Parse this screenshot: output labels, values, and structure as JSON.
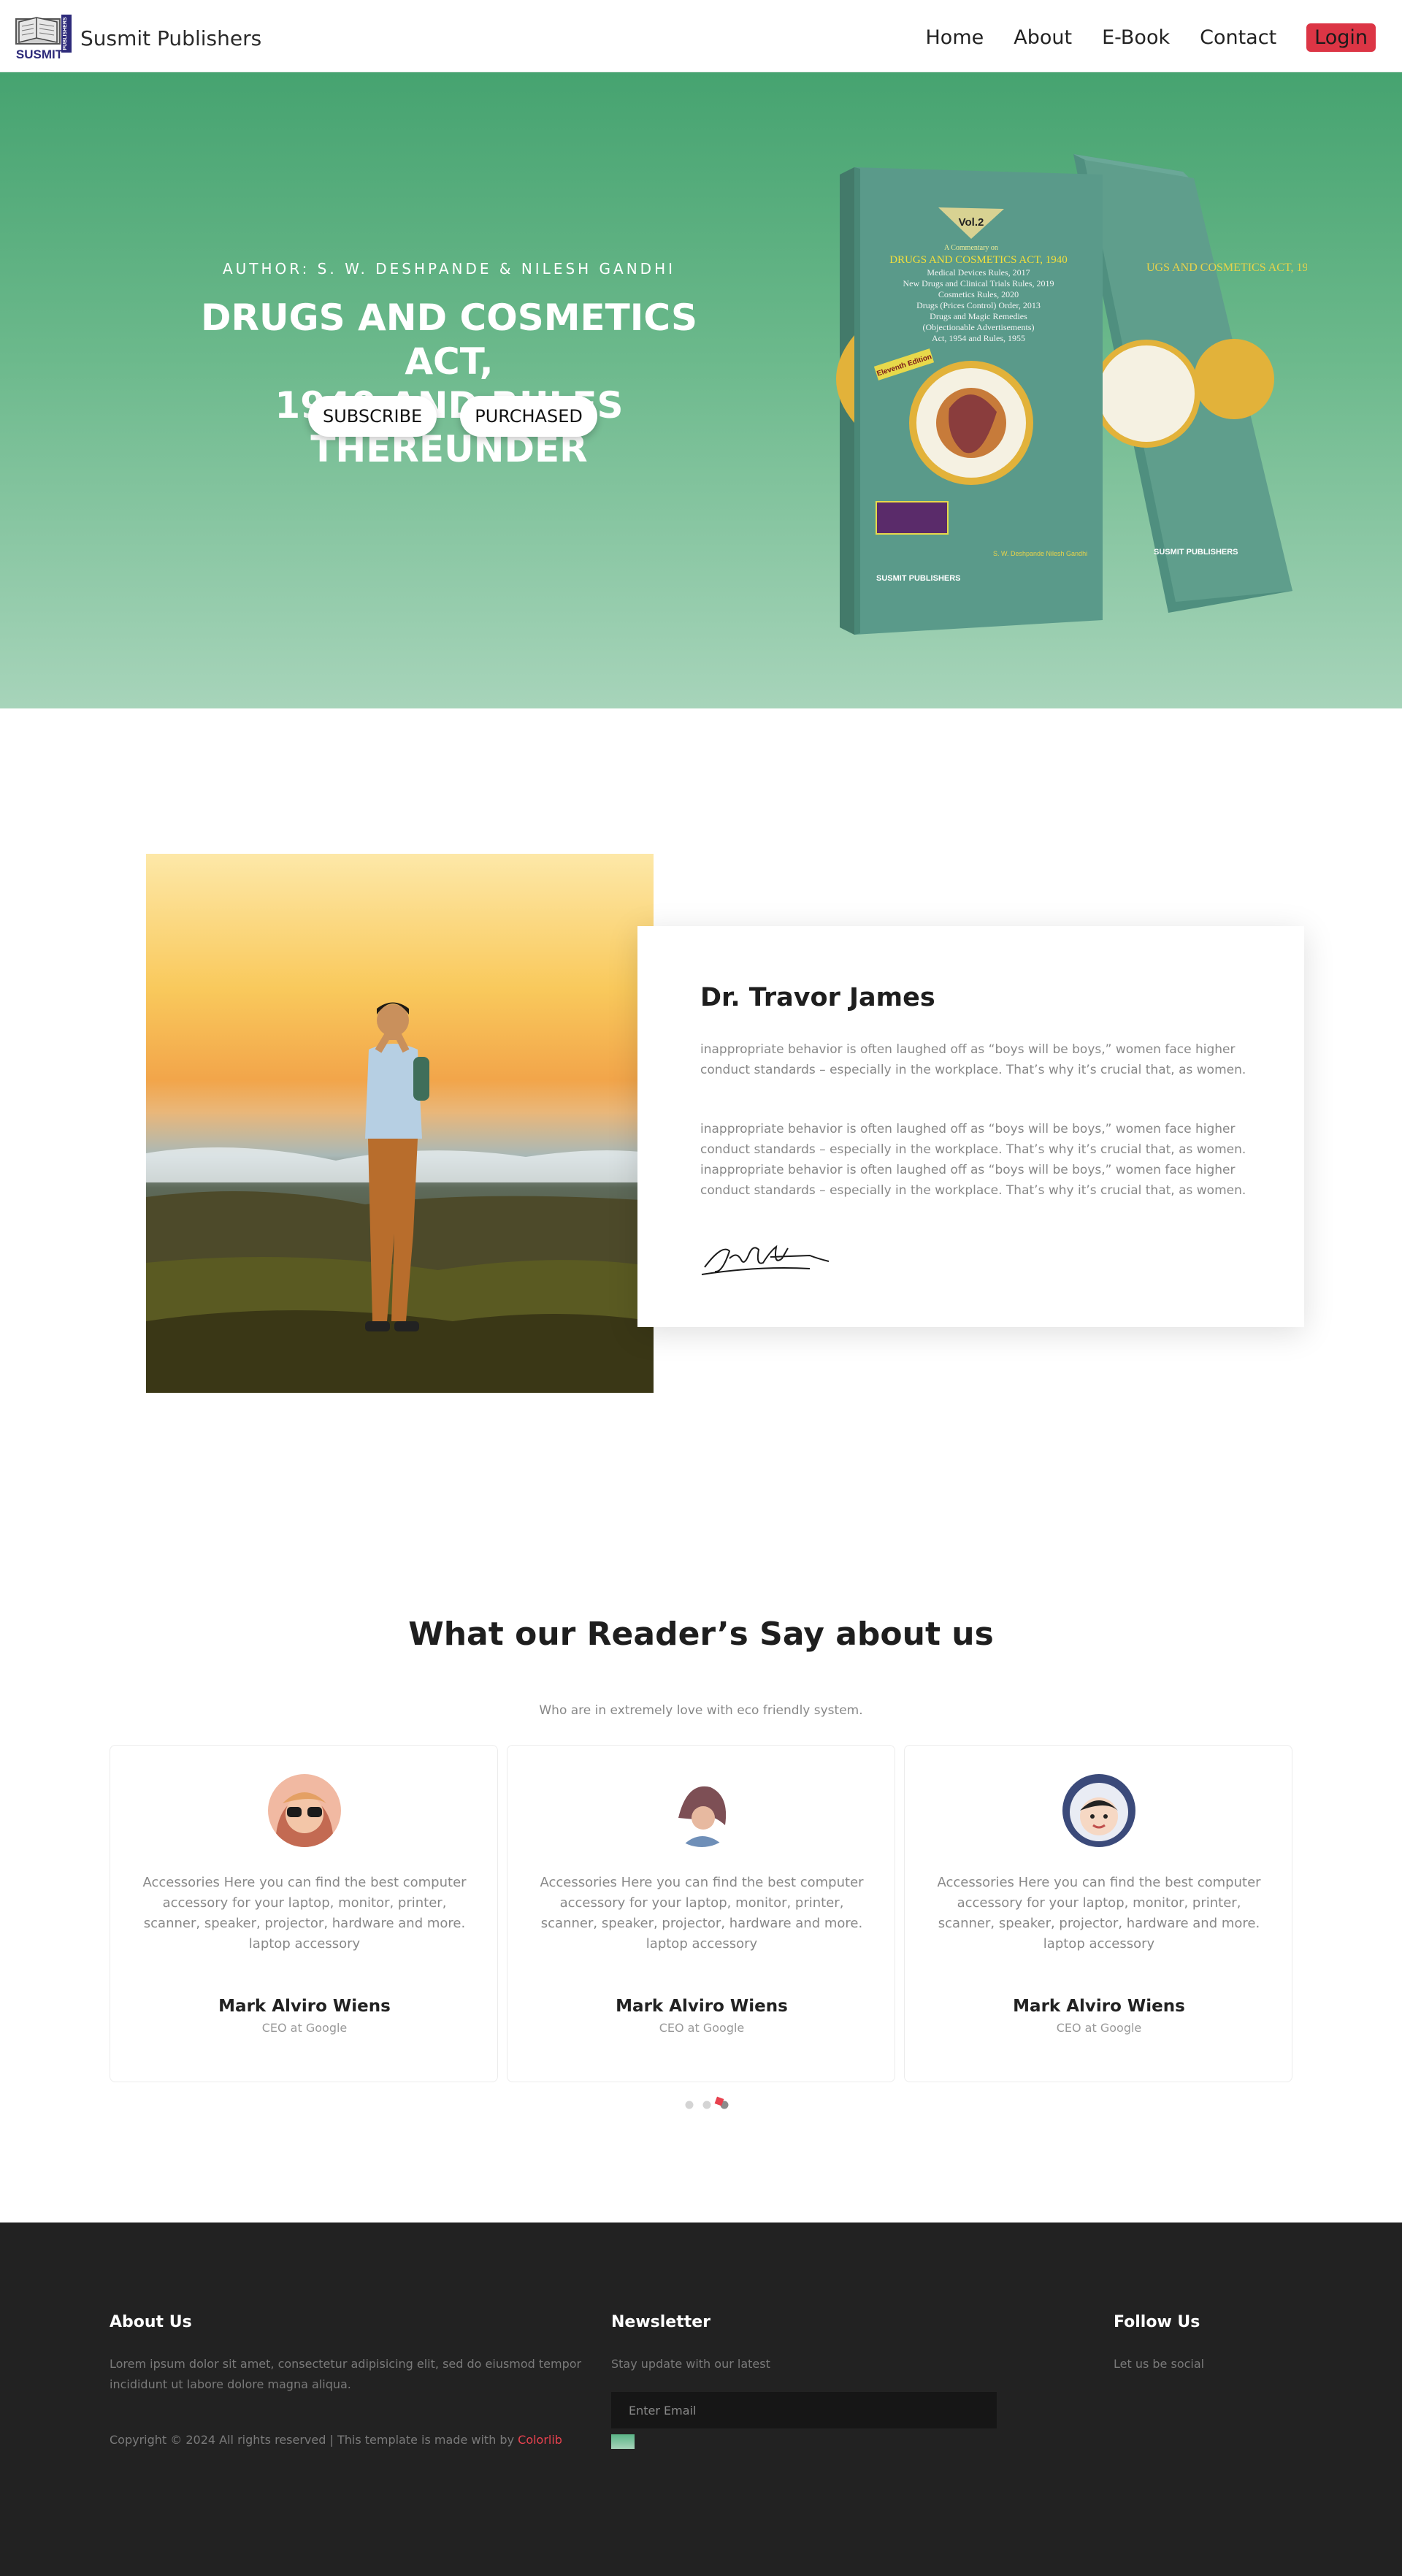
{
  "nav": {
    "logo_text": "SUSMIT",
    "logo_vertical": "PUBLISHERS",
    "brand": "Susmit Publishers",
    "links": [
      "Home",
      "About",
      "E-Book",
      "Contact"
    ],
    "login": "Login"
  },
  "hero": {
    "author": "AUTHOR: S. W. DESHPANDE & NILESH GANDHI",
    "title_line1": "DRUGS AND COSMETICS ACT,",
    "title_line2": "1940 AND RULES THEREUNDER",
    "subscribe": "SUBSCRIBE",
    "purchased": "PURCHASED",
    "book": {
      "vol": "Vol.2",
      "subtitle": "A Commentary on",
      "title": "DRUGS AND COSMETICS ACT, 1940",
      "lines": [
        "Medical Devices Rules, 2017",
        "New Drugs and Clinical Trials Rules, 2019",
        "Cosmetics Rules, 2020",
        "Drugs (Prices Control) Order, 2013",
        "Drugs and Magic Remedies",
        "(Objectionable Advertisements)",
        "Act, 1954 and Rules, 1955"
      ],
      "edition": "Eleventh Edition",
      "authors": "S. W. Deshpande  Nilesh Gandhi",
      "publisher": "SUSMIT PUBLISHERS"
    },
    "colors": {
      "top": "#46a370",
      "bottom": "#a7d4ba"
    }
  },
  "about": {
    "name": "Dr. Travor James",
    "para1": "inappropriate behavior is often laughed off as “boys will be boys,” women face higher conduct standards – especially in the workplace. That’s why it’s crucial that, as women.",
    "para2": "inappropriate behavior is often laughed off as “boys will be boys,” women face higher conduct standards – especially in the workplace. That’s why it’s crucial that, as women. inappropriate behavior is often laughed off as “boys will be boys,” women face higher conduct standards – especially in the workplace. That’s why it’s crucial that, as women.",
    "signature": "signature-image"
  },
  "testimonials": {
    "title": "What our Reader’s Say about us",
    "subtitle": "Who are in extremely love with eco friendly system.",
    "items": [
      {
        "text": "Accessories Here you can find the best computer accessory for your laptop, monitor, printer, scanner, speaker, projector, hardware and more. laptop accessory",
        "name": "Mark Alviro Wiens",
        "role": "CEO at Google"
      },
      {
        "text": "Accessories Here you can find the best computer accessory for your laptop, monitor, printer, scanner, speaker, projector, hardware and more. laptop accessory",
        "name": "Mark Alviro Wiens",
        "role": "CEO at Google"
      },
      {
        "text": "Accessories Here you can find the best computer accessory for your laptop, monitor, printer, scanner, speaker, projector, hardware and more. laptop accessory",
        "name": "Mark Alviro Wiens",
        "role": "CEO at Google"
      }
    ]
  },
  "footer": {
    "about_title": "About Us",
    "about_text": "Lorem ipsum dolor sit amet, consectetur adipisicing elit, sed do eiusmod tempor incididunt ut labore dolore magna aliqua.",
    "copyright": "Copyright © 2024 All rights reserved | This template is made with by ",
    "colorlib": "Colorlib",
    "newsletter_title": "Newsletter",
    "newsletter_text": "Stay update with our latest",
    "email_placeholder": "Enter Email",
    "follow_title": "Follow Us",
    "follow_text": "Let us be social"
  }
}
